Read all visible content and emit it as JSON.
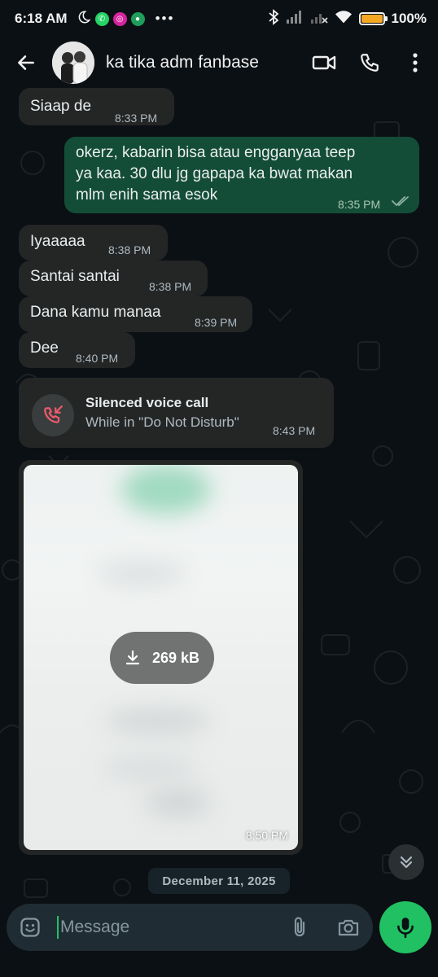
{
  "status_bar": {
    "time": "6:18 AM",
    "battery_level": "100%",
    "battery_fill": 1.0,
    "icons": [
      "moon-icon",
      "whatsapp-icon",
      "instagram-icon",
      "app-icon",
      "more-dots-icon",
      "bluetooth-icon",
      "signal-icon",
      "signal-off-icon",
      "wifi-icon",
      "battery-icon"
    ]
  },
  "header": {
    "contact_name": "ka tika adm fanbase",
    "icons": [
      "back-arrow-icon",
      "avatar",
      "video-call-icon",
      "phone-icon",
      "more-vert-icon"
    ]
  },
  "messages": [
    {
      "direction": "in",
      "text": "Siaap de",
      "time": "8:33 PM"
    },
    {
      "direction": "out",
      "lines": [
        "okerz, kabarin bisa atau engganyaa teep",
        "ya kaa. 30 dlu jg gapapa ka bwat makan",
        "mlm enih sama esok"
      ],
      "time": "8:35 PM",
      "status": "read"
    },
    {
      "direction": "in",
      "text": "Iyaaaaa",
      "time": "8:38 PM"
    },
    {
      "direction": "in",
      "text": "Santai santai",
      "time": "8:38 PM"
    },
    {
      "direction": "in",
      "text": "Dana kamu manaa",
      "time": "8:39 PM"
    },
    {
      "direction": "in",
      "text": "Dee",
      "time": "8:40 PM"
    }
  ],
  "call_event": {
    "title": "Silenced voice call",
    "subtitle": "While in \"Do Not Disturb\"",
    "time": "8:43 PM",
    "icon": "missed-call-icon"
  },
  "image_message": {
    "size_label": "269 kB",
    "time": "8:50 PM",
    "icon": "download-icon"
  },
  "date_separator": "December 11, 2025",
  "composer": {
    "placeholder": "Message",
    "value": "",
    "icons": [
      "emoji-icon",
      "attach-icon",
      "camera-icon",
      "mic-icon"
    ]
  },
  "colors": {
    "background": "#0b1014",
    "incoming_bubble": "#242626",
    "outgoing_bubble": "#144d37",
    "accent_green": "#21c063",
    "missed_call_red": "#f15c6d",
    "battery": "#f5a623"
  }
}
